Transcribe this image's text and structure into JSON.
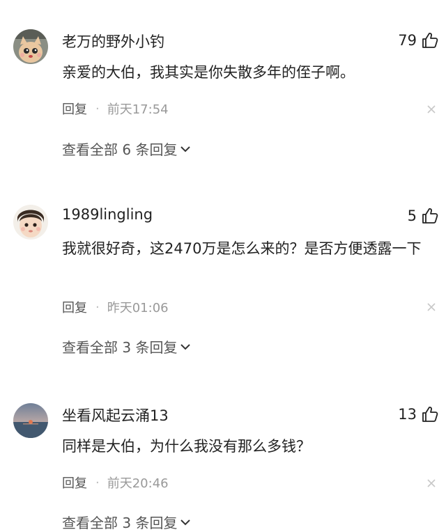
{
  "comments": [
    {
      "username": "老万的野外小钓",
      "likes": "79",
      "text": "亲爱的大伯，我其实是你失散多年的侄子啊。",
      "reply_label": "回复",
      "separator": "·",
      "time": "前天17:54",
      "view_all": "查看全部 6 条回复",
      "avatar_icon": "cartoon-cat-avatar"
    },
    {
      "username": "1989lingling",
      "likes": "5",
      "text": "我就很好奇，这2470万是怎么来的？是否方便透露一下",
      "reply_label": "回复",
      "separator": "·",
      "time": "昨天01:06",
      "view_all": "查看全部 3 条回复",
      "avatar_icon": "child-photo-avatar"
    },
    {
      "username": "坐看风起云涌13",
      "likes": "13",
      "text": "同样是大伯，为什么我没有那么多钱？",
      "reply_label": "回复",
      "separator": "·",
      "time": "前天20:46",
      "view_all": "查看全部 3 条回复",
      "avatar_icon": "sunset-sea-avatar"
    }
  ],
  "icons": {
    "like": "thumbs-up-icon",
    "close": "close-icon",
    "expand": "chevron-down-icon"
  },
  "colors": {
    "text": "#222222",
    "meta": "#999999",
    "link": "#555555"
  }
}
